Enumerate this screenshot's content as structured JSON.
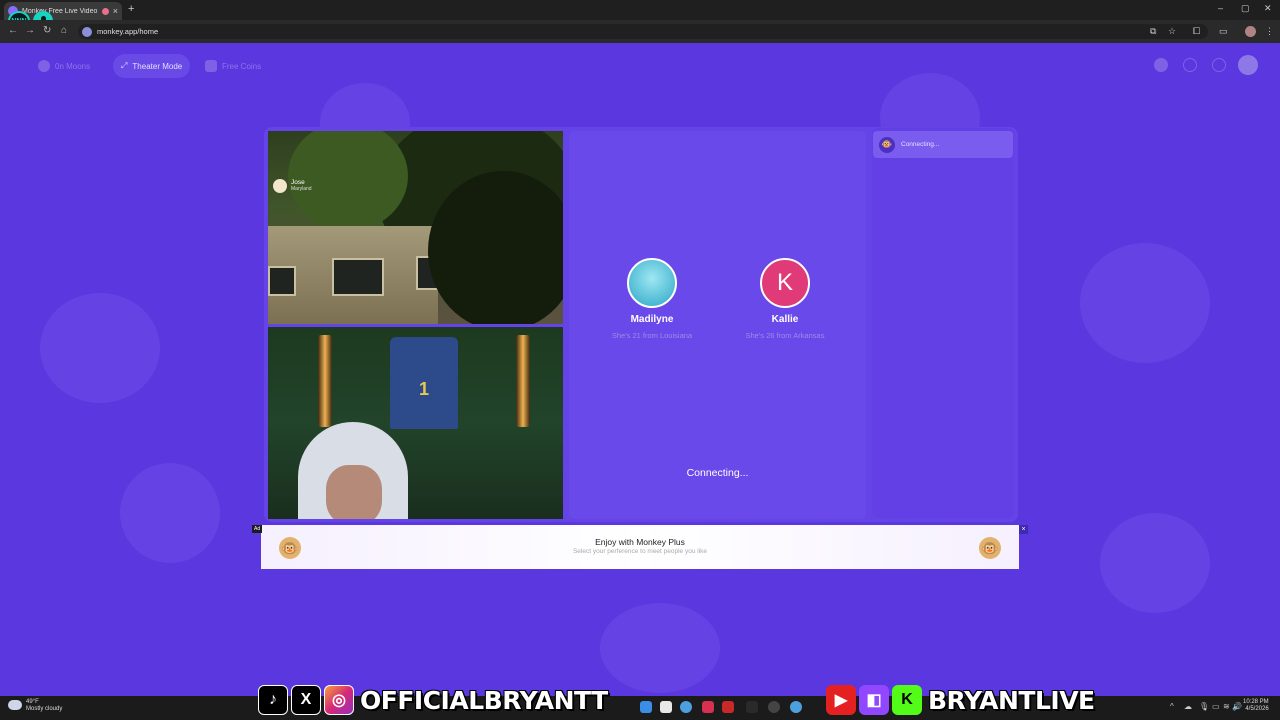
{
  "browser": {
    "tab_title": "Monkey Free Live Video Ch",
    "tab_close": "×",
    "new_tab": "+",
    "url": "monkey.app/home",
    "stream_logo_text": "NNN"
  },
  "window_controls": {
    "minimize": "–",
    "maximize": "▢",
    "close": "✕"
  },
  "nav_icons": {
    "back": "←",
    "forward": "→",
    "reload": "↻",
    "home": "⌂"
  },
  "toolbar": {
    "install": "⧉",
    "star": "☆",
    "extensions": "⧠",
    "sidebar": "▭",
    "menu": "⋮"
  },
  "topnav": {
    "moons": "0n Moons",
    "theater": "Theater Mode",
    "theater_icon": "⤢",
    "coins": "Free Coins"
  },
  "caller": {
    "name": "Jose",
    "location": "Maryland"
  },
  "jersey_number": "1",
  "matches": [
    {
      "name": "Madilyne",
      "subtitle": "She's 21 from Louisiana",
      "initial": ""
    },
    {
      "name": "Kallie",
      "subtitle": "She's 26 from Arkansas",
      "initial": "K"
    }
  ],
  "connecting_main": "Connecting...",
  "chat_status": "Connecting...",
  "chat_emoji": "🐵",
  "ad": {
    "label": "Ad",
    "title": "Enjoy with Monkey Plus",
    "subtitle": "Select your perference to meet people you like",
    "close": "×",
    "emoji": "🐵"
  },
  "taskbar": {
    "temp": "49°F",
    "weather": "Mostly cloudy",
    "time": "10:28 PM",
    "date": "4/5/2026",
    "tray_chevron": "^",
    "tray_cloud": "☁",
    "tray_mic": "🎙",
    "tray_monitor": "▭",
    "tray_wifi": "≋",
    "tray_volume": "🔊"
  },
  "overlay": {
    "left_handle": "OFFICIALBRYANTT",
    "right_handle": "BRYANTLIVE",
    "tiktok": "♪",
    "x": "X",
    "instagram": "◎",
    "youtube": "▶",
    "twitch": "◧",
    "kick": "K"
  },
  "colors": {
    "page_bg": "#5a37de",
    "card_bg": "#6444e6",
    "accent_pink": "#e03a78",
    "accent_teal": "#18d3c0"
  }
}
